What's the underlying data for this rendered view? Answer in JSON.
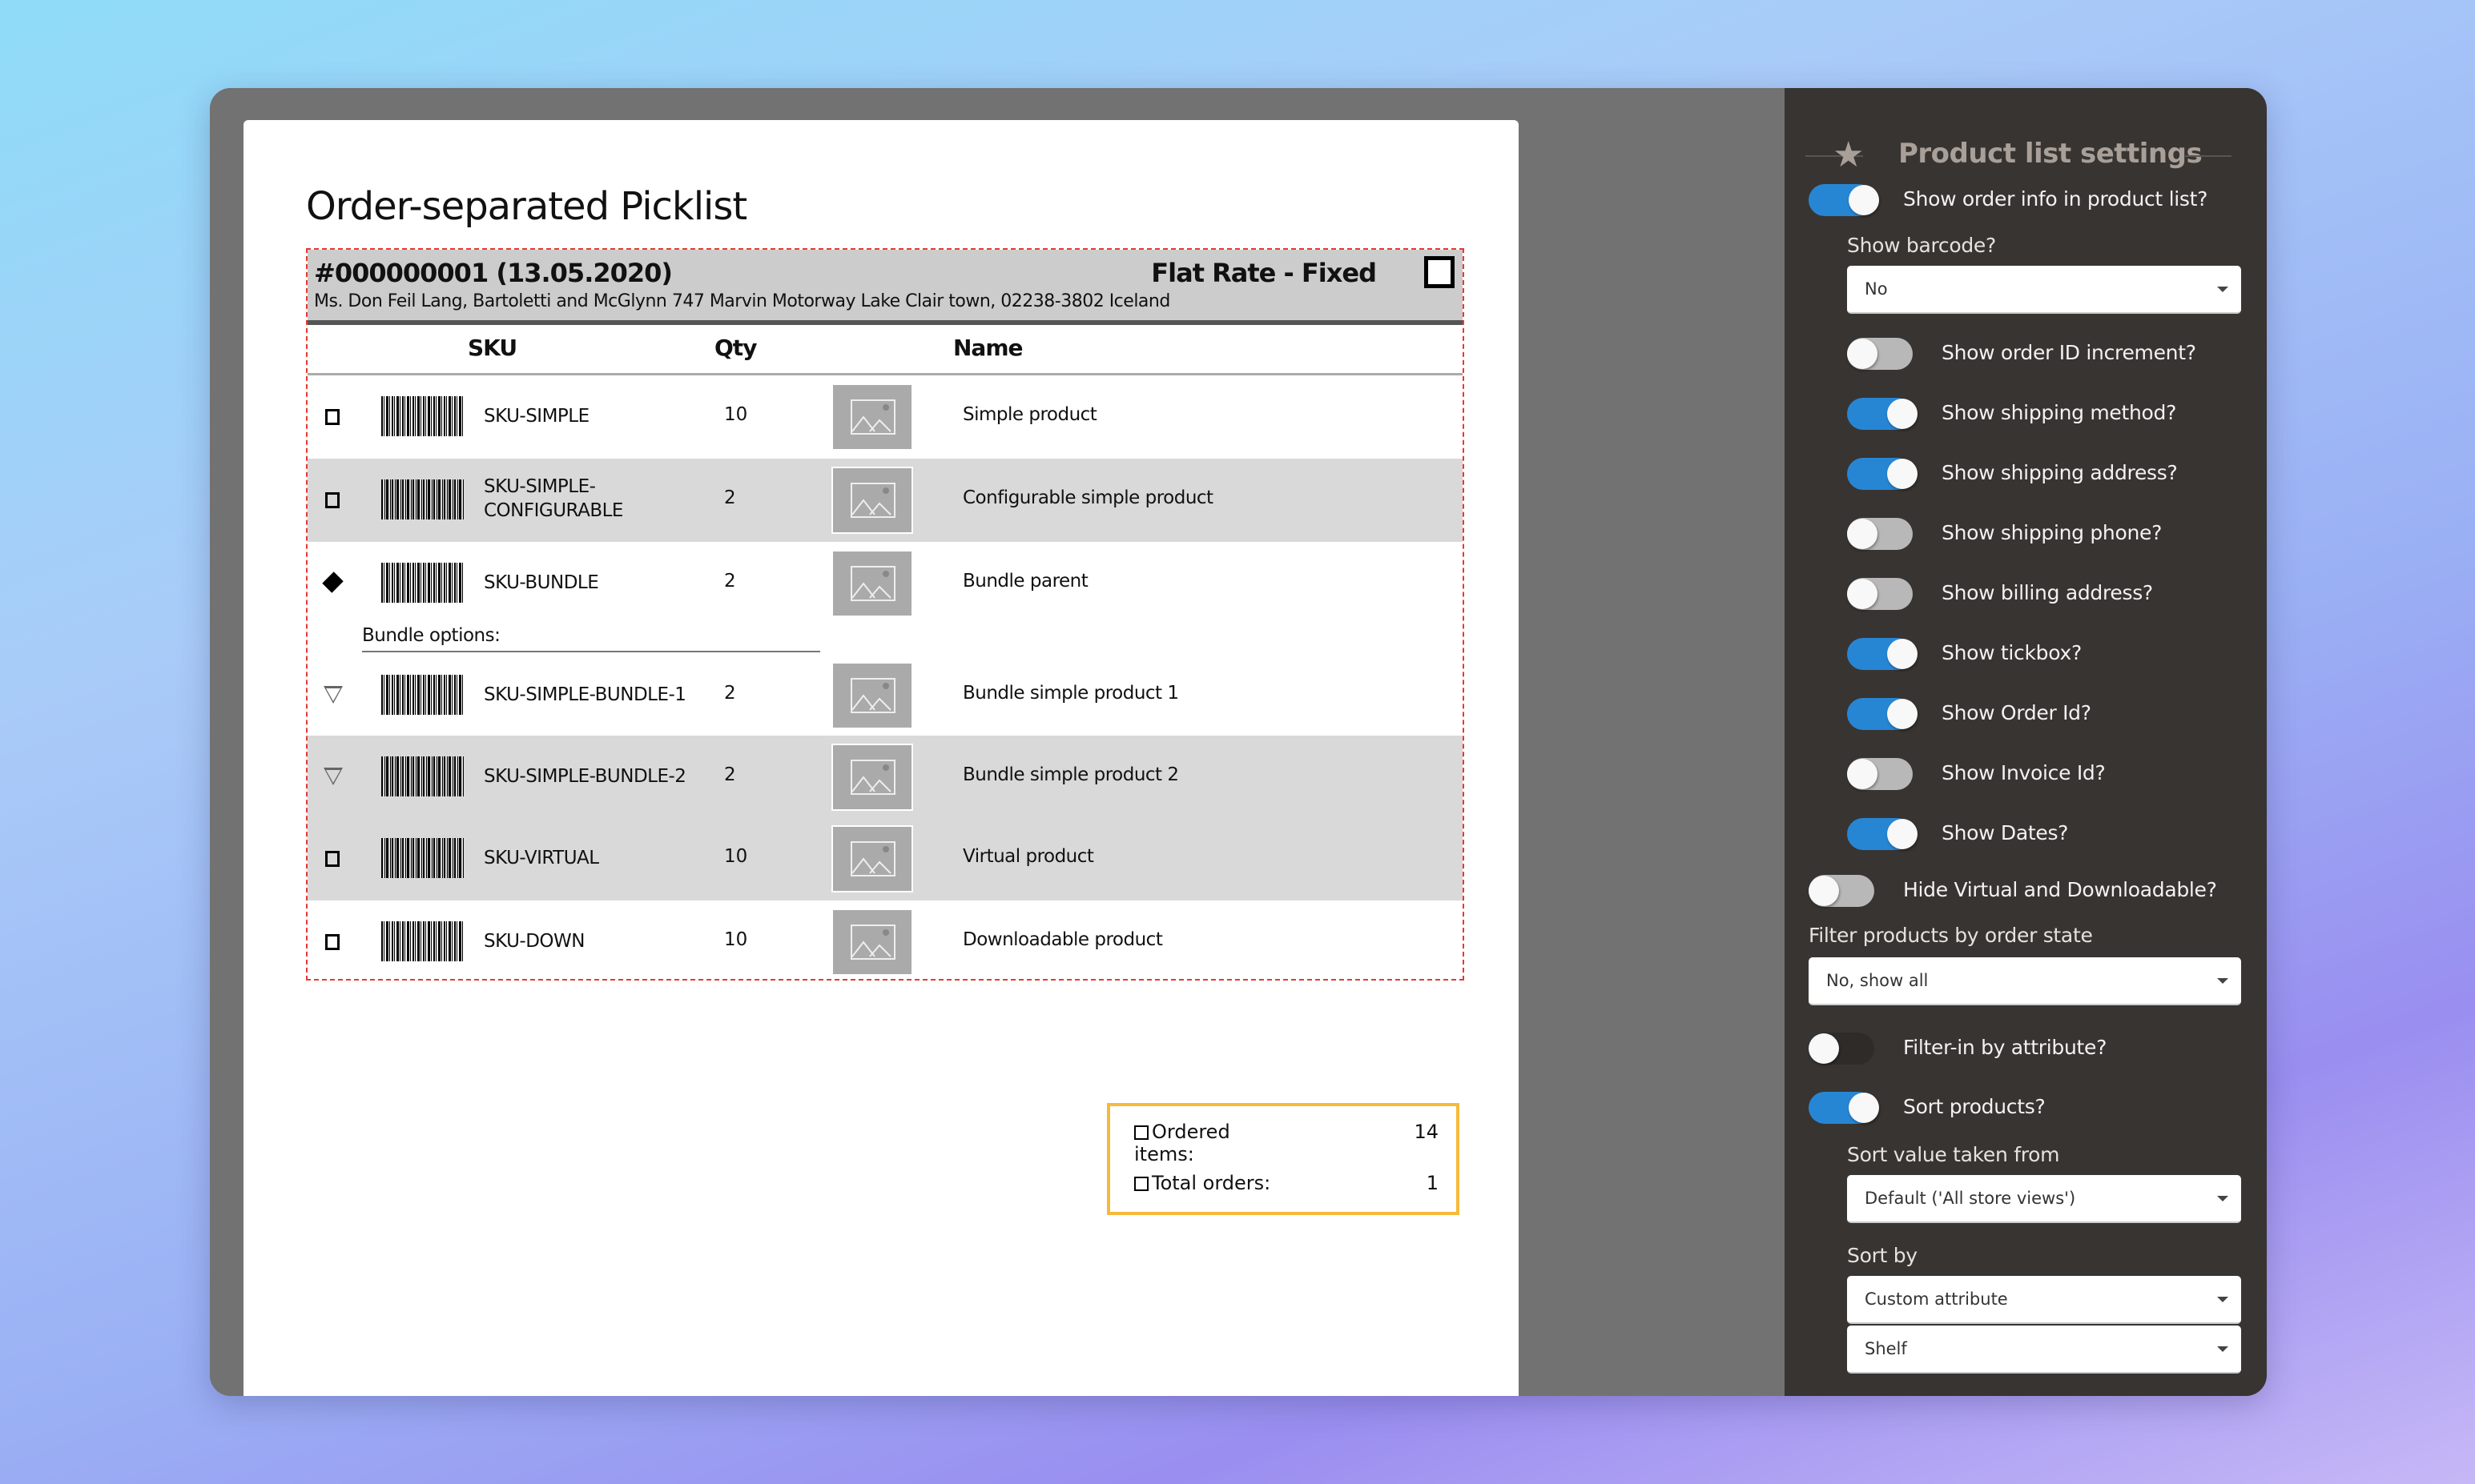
{
  "picklist": {
    "title": "Order-separated Picklist",
    "order": {
      "id_date": "#000000001 (13.05.2020)",
      "shipping_method": "Flat Rate - Fixed",
      "address": "Ms. Don Feil Lang, Bartoletti and McGlynn 747 Marvin Motorway Lake Clair town, 02238-3802 Iceland"
    },
    "columns": {
      "sku": "SKU",
      "qty": "Qty",
      "name": "Name"
    },
    "items": [
      {
        "marker": "square",
        "sku": "SKU-SIMPLE",
        "qty": "10",
        "name": "Simple product"
      },
      {
        "marker": "square",
        "sku": "SKU-SIMPLE-\nCONFIGURABLE",
        "qty": "2",
        "name": "Configurable simple product"
      },
      {
        "marker": "diamond",
        "sku": "SKU-BUNDLE",
        "qty": "2",
        "name": "Bundle parent"
      }
    ],
    "bundle_options_label": "Bundle options:",
    "bundle_items": [
      {
        "marker": "triangle",
        "sku": "SKU-SIMPLE-BUNDLE-1",
        "qty": "2",
        "name": "Bundle simple product 1"
      },
      {
        "marker": "triangle",
        "sku": "SKU-SIMPLE-BUNDLE-2",
        "qty": "2",
        "name": "Bundle simple product 2"
      }
    ],
    "more_items": [
      {
        "marker": "square",
        "sku": "SKU-VIRTUAL",
        "qty": "10",
        "name": "Virtual product"
      },
      {
        "marker": "square",
        "sku": "SKU-DOWN",
        "qty": "10",
        "name": "Downloadable product"
      }
    ],
    "totals": {
      "ordered_items_label": "Ordered items:",
      "ordered_items_value": "14",
      "total_orders_label": "Total orders:",
      "total_orders_value": "1"
    }
  },
  "settings": {
    "title": "Product list settings",
    "icon": "star-icon",
    "show_order_info": {
      "label": "Show order info in product list?",
      "on": true
    },
    "show_barcode": {
      "label": "Show barcode?",
      "value": "No"
    },
    "toggles": [
      {
        "label": "Show order ID increment?",
        "on": false
      },
      {
        "label": "Show shipping method?",
        "on": true
      },
      {
        "label": "Show shipping address?",
        "on": true
      },
      {
        "label": "Show shipping phone?",
        "on": false
      },
      {
        "label": "Show billing address?",
        "on": false
      },
      {
        "label": "Show tickbox?",
        "on": true
      },
      {
        "label": "Show Order Id?",
        "on": true
      },
      {
        "label": "Show Invoice Id?",
        "on": false
      },
      {
        "label": "Show Dates?",
        "on": true
      }
    ],
    "hide_virtual": {
      "label": "Hide Virtual and Downloadable?",
      "on": false
    },
    "filter_state": {
      "label": "Filter products by order state",
      "value": "No, show all"
    },
    "filter_attribute": {
      "label": "Filter-in by attribute?",
      "on": false
    },
    "sort_products": {
      "label": "Sort products?",
      "on": true
    },
    "sort_source": {
      "label": "Sort value taken from",
      "value": "Default ('All store views')"
    },
    "sort_by": {
      "label": "Sort by",
      "value": "Custom attribute",
      "attribute": "Shelf"
    },
    "colors": {
      "accent": "#2786d4",
      "panel": "#383431",
      "totals_border": "#f6b93b",
      "order_border": "#e53935"
    }
  }
}
